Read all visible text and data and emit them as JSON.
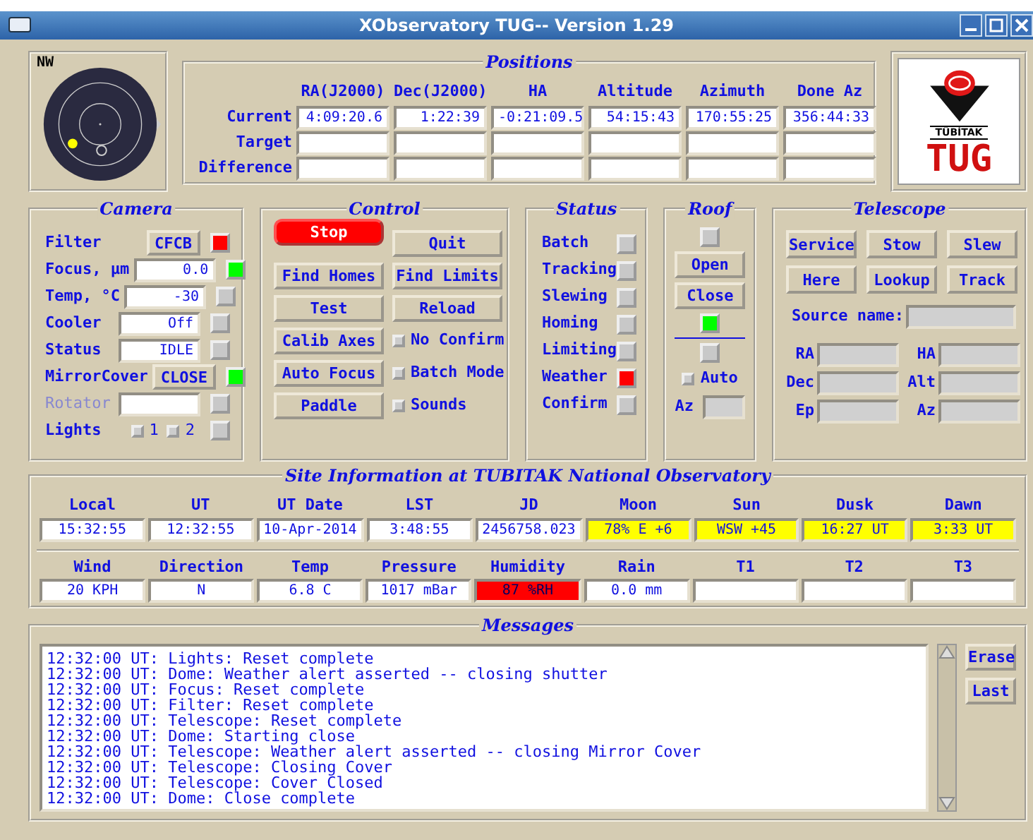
{
  "window": {
    "title": "XObservatory TUG-- Version 1.29"
  },
  "sky": {
    "label": "NW"
  },
  "positions": {
    "title": "Positions",
    "columns": [
      "RA(J2000)",
      "Dec(J2000)",
      "HA",
      "Altitude",
      "Azimuth",
      "Done Az"
    ],
    "rows": [
      {
        "label": "Current",
        "values": [
          "4:09:20.6",
          "1:22:39",
          "-0:21:09.5",
          "54:15:43",
          "170:55:25",
          "356:44:33"
        ]
      },
      {
        "label": "Target"
      },
      {
        "label": "Difference"
      }
    ]
  },
  "logo": {
    "name": "TÜBİTAK",
    "short": "TUG"
  },
  "camera": {
    "title": "Camera",
    "rows": [
      {
        "kind": "button",
        "label": "Filter",
        "value": "CFCB",
        "color": "#ff0000"
      },
      {
        "kind": "field",
        "label": "Focus, µm",
        "value": "0.0",
        "color": "#00ff00"
      },
      {
        "kind": "field",
        "label": "Temp, °C",
        "value": "-30",
        "color": "#c8c8c8"
      },
      {
        "kind": "field",
        "label": "Cooler",
        "value": "Off",
        "color": "#c8c8c8"
      },
      {
        "kind": "field",
        "label": "Status",
        "value": "IDLE",
        "color": "#c8c8c8"
      },
      {
        "kind": "button",
        "label": "MirrorCover",
        "value": "CLOSE",
        "color": "#00ff00"
      },
      {
        "kind": "field",
        "label": "Rotator",
        "disabled": true,
        "color": "#c8c8c8"
      },
      {
        "kind": "lights",
        "label": "Lights",
        "options": [
          {
            "label": "1",
            "checked": false
          },
          {
            "label": "2",
            "checked": false
          }
        ],
        "color": "#c8c8c8"
      }
    ]
  },
  "control": {
    "title": "Control",
    "items": [
      {
        "kind": "button",
        "label": "Stop",
        "alert": true
      },
      {
        "kind": "button",
        "label": "Quit",
        "alert": false
      },
      {
        "kind": "button",
        "label": "Find Homes",
        "alert": false
      },
      {
        "kind": "button",
        "label": "Find Limits",
        "alert": false
      },
      {
        "kind": "button",
        "label": "Test",
        "alert": false
      },
      {
        "kind": "button",
        "label": "Reload",
        "alert": false
      },
      {
        "kind": "button",
        "label": "Calib Axes",
        "alert": false
      },
      {
        "kind": "checkbox",
        "label": "No Confirm",
        "checked": false
      },
      {
        "kind": "button",
        "label": "Auto Focus",
        "alert": false
      },
      {
        "kind": "checkbox",
        "label": "Batch Mode",
        "checked": false
      },
      {
        "kind": "button",
        "label": "Paddle",
        "alert": false
      },
      {
        "kind": "checkbox",
        "label": "Sounds",
        "checked": false
      }
    ]
  },
  "status": {
    "title": "Status",
    "items": [
      {
        "label": "Batch",
        "color": "#c8c8c8"
      },
      {
        "label": "Tracking",
        "color": "#c8c8c8"
      },
      {
        "label": "Slewing",
        "color": "#c8c8c8"
      },
      {
        "label": "Homing",
        "color": "#c8c8c8"
      },
      {
        "label": "Limiting",
        "color": "#c8c8c8"
      },
      {
        "label": "Weather",
        "color": "#ff0000"
      },
      {
        "label": "Confirm",
        "color": "#c8c8c8"
      }
    ]
  },
  "roof": {
    "title": "Roof",
    "items": [
      {
        "kind": "led",
        "color": "#c8c8c8"
      },
      {
        "kind": "button",
        "label": "Open"
      },
      {
        "kind": "button",
        "label": "Close"
      },
      {
        "kind": "led",
        "color": "#00ff00"
      },
      {
        "kind": "divider"
      },
      {
        "kind": "led",
        "color": "#c8c8c8"
      },
      {
        "kind": "checkbox",
        "label": "Auto",
        "checked": false
      },
      {
        "kind": "field",
        "label": "Az"
      }
    ]
  },
  "telescope": {
    "title": "Telescope",
    "buttons": [
      "Service",
      "Stow",
      "Slew",
      "Here",
      "Lookup",
      "Track"
    ],
    "source_label": "Source name:",
    "coords": [
      "RA",
      "HA",
      "Dec",
      "Alt",
      "Ep",
      "Az"
    ]
  },
  "site": {
    "title": "Site Information at TUBITAK National Observatory",
    "rows": [
      [
        {
          "label": "Local",
          "value": "15:32:55"
        },
        {
          "label": "UT",
          "value": "12:32:55"
        },
        {
          "label": "UT Date",
          "value": "10-Apr-2014"
        },
        {
          "label": "LST",
          "value": "3:48:55"
        },
        {
          "label": "JD",
          "value": "2456758.023"
        },
        {
          "label": "Moon",
          "value": "78%  E +6",
          "color": "#ffff00"
        },
        {
          "label": "Sun",
          "value": "WSW +45",
          "color": "#ffff00"
        },
        {
          "label": "Dusk",
          "value": "16:27 UT",
          "color": "#ffff00"
        },
        {
          "label": "Dawn",
          "value": "3:33 UT",
          "color": "#ffff00"
        }
      ],
      [
        {
          "label": "Wind",
          "value": "20 KPH"
        },
        {
          "label": "Direction",
          "value": "N"
        },
        {
          "label": "Temp",
          "value": "6.8 C"
        },
        {
          "label": "Pressure",
          "value": "1017 mBar"
        },
        {
          "label": "Humidity",
          "value": "87 %RH",
          "color": "#ff0000"
        },
        {
          "label": "Rain",
          "value": "0.0 mm"
        },
        {
          "label": "T1"
        },
        {
          "label": "T2"
        },
        {
          "label": "T3"
        }
      ]
    ]
  },
  "messages": {
    "title": "Messages",
    "lines": [
      "12:32:00 UT: Lights: Reset complete",
      "12:32:00 UT: Dome: Weather alert asserted -- closing shutter",
      "12:32:00 UT: Focus: Reset complete",
      "12:32:00 UT: Filter: Reset complete",
      "12:32:00 UT: Telescope: Reset complete",
      "12:32:00 UT: Dome: Starting close",
      "12:32:00 UT: Telescope: Weather alert asserted -- closing Mirror Cover",
      "12:32:00 UT: Telescope: Closing Cover",
      "12:32:00 UT: Telescope: Cover Closed",
      "12:32:00 UT: Dome: Close complete"
    ],
    "buttons": [
      "Erase",
      "Last"
    ]
  }
}
